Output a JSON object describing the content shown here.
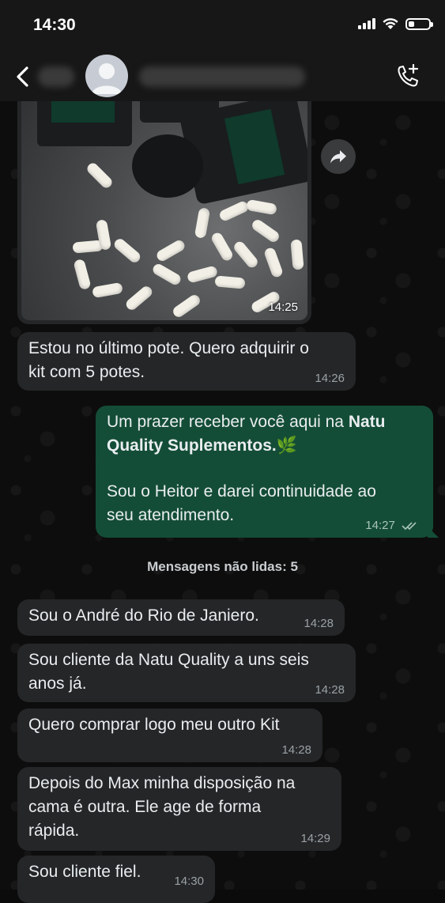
{
  "status_bar": {
    "time": "14:30"
  },
  "image_message": {
    "time": "14:25"
  },
  "messages": [
    {
      "lines": [
        "Estou no último pote. Quero adquirir o",
        "kit com 5 potes."
      ],
      "time": "14:26"
    },
    {
      "line1_prefix": "Um prazer receber você aqui na ",
      "line1_bold": "Natu",
      "line2_bold": "Quality Suplementos.",
      "line2_emoji": "🌿",
      "line3": "Sou o Heitor e darei continuidade ao",
      "line4": "seu atendimento.",
      "time": "14:27"
    }
  ],
  "unread_divider": "Mensagens não lidas: 5",
  "incoming": [
    {
      "lines": [
        "Sou o André do Rio de Janiero."
      ],
      "time": "14:28"
    },
    {
      "lines": [
        "Sou cliente da Natu Quality a uns seis",
        "anos já."
      ],
      "time": "14:28"
    },
    {
      "lines": [
        "Quero comprar logo meu outro Kit"
      ],
      "time": "14:28"
    },
    {
      "lines": [
        "Depois do Max minha disposição na",
        "cama é outra. Ele age de forma",
        "rápida."
      ],
      "time": "14:29"
    },
    {
      "lines": [
        "Sou cliente fiel."
      ],
      "time": "14:30"
    }
  ],
  "icons": {
    "back": "chevron-left-icon",
    "avatar": "avatar",
    "call": "add-call-icon",
    "forward": "forward-icon",
    "read_receipt": "double-check-icon"
  },
  "colors": {
    "outgoing_bubble": "#144d37",
    "incoming_bubble": "#252628",
    "background": "#0d0d0d"
  }
}
